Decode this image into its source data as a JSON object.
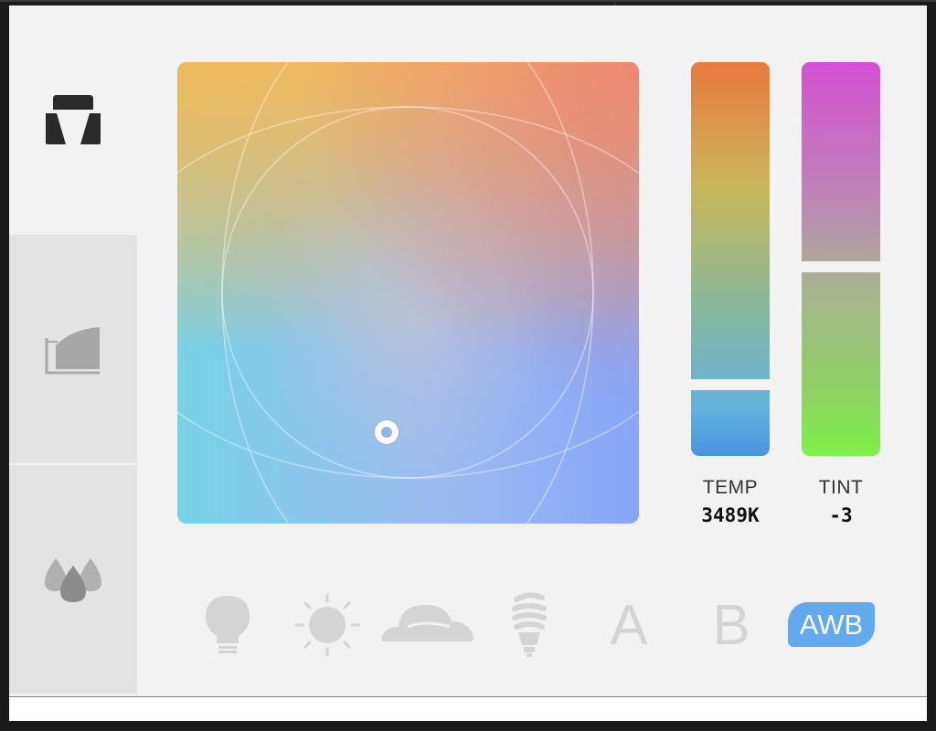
{
  "sidebar": {
    "tabs": [
      {
        "id": "white-balance",
        "icon": "white-balance-icon",
        "active": true
      },
      {
        "id": "curves",
        "icon": "curves-icon",
        "active": false
      },
      {
        "id": "color",
        "icon": "color-drops-icon",
        "active": false
      }
    ]
  },
  "wheel": {
    "handle_icon": "target-handle-icon"
  },
  "temp": {
    "label": "TEMP",
    "value": "3489K",
    "level": 0.82,
    "colors": [
      "#e9793c",
      "#c9b75b",
      "#62b2de",
      "#4d92df"
    ]
  },
  "tint": {
    "label": "TINT",
    "value": "-3",
    "level": 0.52,
    "colors": [
      "#d54fd3",
      "#bd86b6",
      "#8fd066",
      "#7ff04a"
    ]
  },
  "presets": [
    {
      "id": "incandescent",
      "icon": "lightbulb-icon"
    },
    {
      "id": "daylight",
      "icon": "sun-icon"
    },
    {
      "id": "cloudy",
      "icon": "cloud-icon"
    },
    {
      "id": "fluorescent",
      "icon": "cfl-bulb-icon"
    },
    {
      "id": "custom-a",
      "label": "A"
    },
    {
      "id": "custom-b",
      "label": "B"
    },
    {
      "id": "auto",
      "label": "AWB",
      "selected": true,
      "color": "#62a9ee"
    }
  ]
}
